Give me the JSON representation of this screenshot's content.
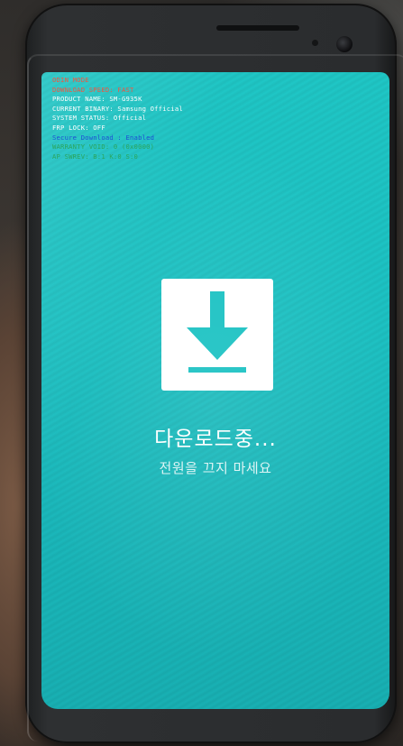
{
  "device_info": {
    "lines": [
      {
        "text": "ODIN MODE",
        "color": "#f2553f"
      },
      {
        "text": "DOWNLOAD SPEED: FAST",
        "color": "#f2553f"
      },
      {
        "text": "PRODUCT NAME: SM-G935K",
        "color": "#ffffff"
      },
      {
        "text": "CURRENT BINARY: Samsung Official",
        "color": "#ffffff"
      },
      {
        "text": "SYSTEM STATUS: Official",
        "color": "#ffffff"
      },
      {
        "text": "FRP LOCK: OFF",
        "color": "#ffffff"
      },
      {
        "text": "Secure Download : Enabled",
        "color": "#1e4fd6"
      },
      {
        "text": "WARRANTY VOID: 0 (0x0000)",
        "color": "#2aa55a"
      },
      {
        "text": "AP SWREV: B:1 K:0 S:0",
        "color": "#2aa55a"
      }
    ]
  },
  "download": {
    "icon": "download-arrow-icon",
    "title": "다운로드중...",
    "subtitle": "전원을 끄지 마세요"
  },
  "colors": {
    "screen_background": "#1cc2c3",
    "icon_background": "#ffffff",
    "icon_glyph": "#1cc2c3"
  }
}
